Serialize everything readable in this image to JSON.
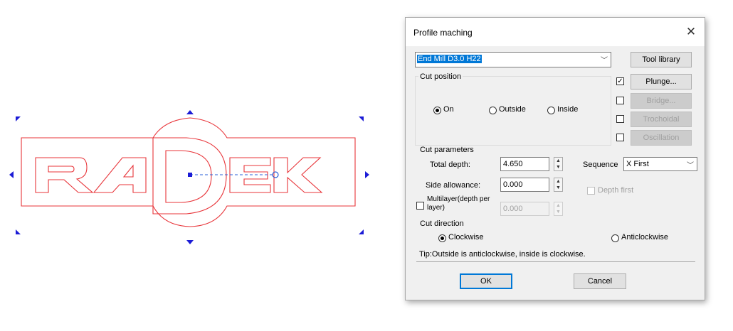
{
  "dialog": {
    "title": "Profile maching",
    "close_glyph": "✕",
    "tool_select": {
      "value": "End Mill D3.0 H22"
    },
    "tool_library_label": "Tool library",
    "plunge": {
      "label": "Plunge...",
      "checked": true
    },
    "bridge": {
      "label": "Bridge...",
      "checked": false,
      "enabled": false
    },
    "trochoidal": {
      "label": "Trochoidal",
      "checked": false,
      "enabled": false
    },
    "oscillation": {
      "label": "Oscillation",
      "checked": false,
      "enabled": false
    },
    "cut_position": {
      "label": "Cut position",
      "options": [
        "On",
        "Outside",
        "Inside"
      ],
      "selected": "On"
    },
    "cut_parameters": {
      "label": "Cut parameters",
      "total_depth_label": "Total depth:",
      "total_depth_value": "4.650",
      "side_allowance_label": "Side allowance:",
      "side_allowance_value": "0.000",
      "multilayer_label_1": "Multilayer(depth per",
      "multilayer_label_2": "layer)",
      "multilayer_value": "0.000",
      "sequence_label": "Sequence",
      "sequence_value": "X First",
      "depth_first_label": "Depth first"
    },
    "cut_direction": {
      "label": "Cut direction",
      "options": [
        "Clockwise",
        "Anticlockwise"
      ],
      "selected": "Clockwise"
    },
    "tip": "Tip:Outside is anticlockwise, inside is clockwise.",
    "ok_label": "OK",
    "cancel_label": "Cancel"
  },
  "canvas": {
    "logo_text": "RADEK",
    "outline_color": "#e8353a",
    "handle_color": "#1c1cd6",
    "path_color": "#2a5fd8"
  }
}
